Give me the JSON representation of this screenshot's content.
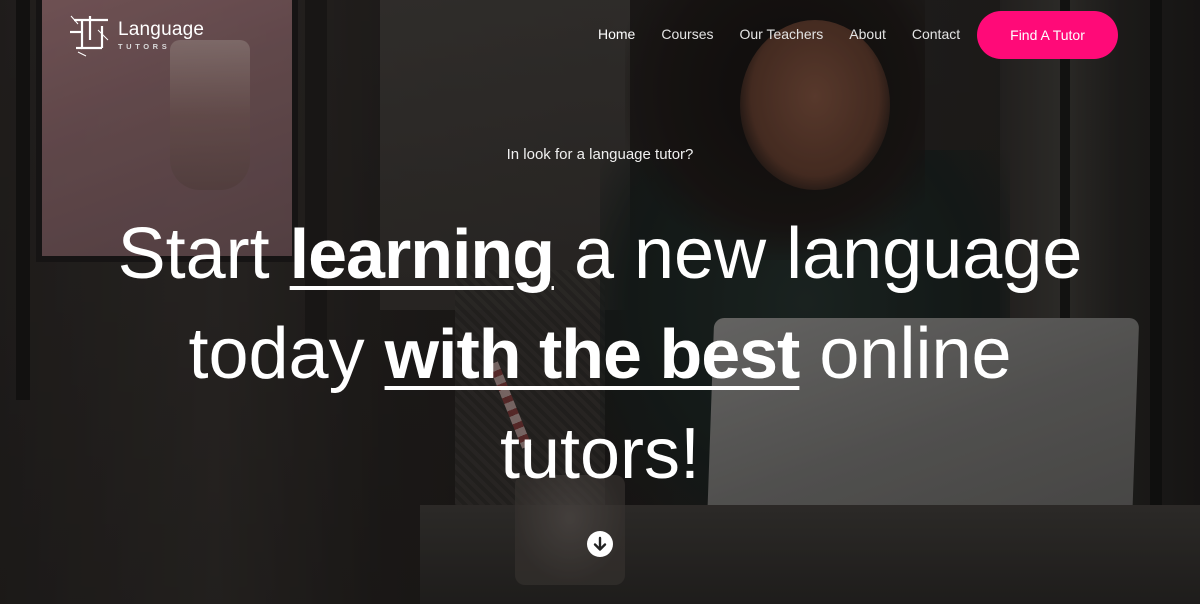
{
  "brand": {
    "name": "Language",
    "tagline": "TUTORS"
  },
  "nav": {
    "items": [
      {
        "label": "Home",
        "active": true
      },
      {
        "label": "Courses",
        "active": false
      },
      {
        "label": "Our Teachers",
        "active": false
      },
      {
        "label": "About",
        "active": false
      },
      {
        "label": "Contact",
        "active": false
      }
    ],
    "cta_label": "Find A Tutor"
  },
  "hero": {
    "kicker": "In look for a language tutor?",
    "headline": {
      "part1": "Start ",
      "emphasis1": "learning",
      "part2": " a new language today ",
      "emphasis2": "with the best",
      "part3": " online tutors!"
    },
    "scroll_icon": "arrow-down-circle-icon"
  },
  "colors": {
    "accent": "#ff0a78",
    "text": "#ffffff"
  }
}
